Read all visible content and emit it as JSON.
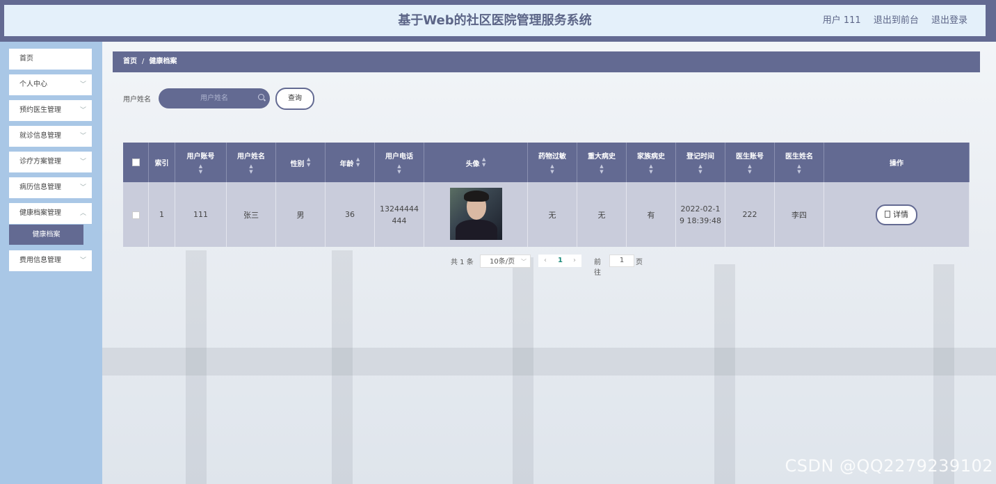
{
  "header": {
    "title": "基于Web的社区医院管理服务系统",
    "user": "用户 111",
    "back_front": "退出到前台",
    "logout": "退出登录"
  },
  "sidebar": {
    "items": [
      {
        "label": "首页"
      },
      {
        "label": "个人中心"
      },
      {
        "label": "预约医生管理"
      },
      {
        "label": "就诊信息管理"
      },
      {
        "label": "诊疗方案管理"
      },
      {
        "label": "病历信息管理"
      },
      {
        "label": "健康档案管理"
      },
      {
        "label": "费用信息管理"
      }
    ],
    "active_sub": "健康档案"
  },
  "breadcrumb": {
    "home": "首页",
    "sep": "/",
    "current": "健康档案"
  },
  "search": {
    "label": "用户姓名",
    "placeholder": "用户姓名",
    "button": "查询"
  },
  "table": {
    "headers": [
      "索引",
      "用户账号",
      "用户姓名",
      "性别",
      "年龄",
      "用户电话",
      "头像",
      "药物过敏",
      "重大病史",
      "家族病史",
      "登记时间",
      "医生账号",
      "医生姓名",
      "操作"
    ],
    "rows": [
      {
        "index": "1",
        "account": "111",
        "name": "张三",
        "gender": "男",
        "age": "36",
        "phone_a": "13244444",
        "phone_b": "444",
        "allergy": "无",
        "major_history": "无",
        "family_history": "有",
        "time_a": "2022-02-1",
        "time_b": "9 18:39:48",
        "doctor_account": "222",
        "doctor_name": "李四",
        "action": "详情"
      }
    ]
  },
  "pagination": {
    "total": "共 1 条",
    "page_size": "10条/页",
    "current_page": "1",
    "goto_label": "前往",
    "goto_value": "1",
    "goto_suffix": "页"
  },
  "watermark": "CSDN @QQ2279239102",
  "colors": {
    "primary": "#636a92",
    "sidebar": "#a9c7e6",
    "header_bg": "#e4f0fa",
    "row_bg": "#c9ccdb"
  }
}
